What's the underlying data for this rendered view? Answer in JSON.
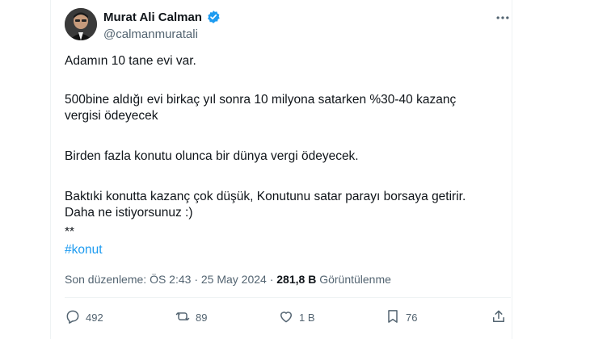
{
  "author": {
    "name": "Murat Ali Calman",
    "handle": "@calmanmuratali"
  },
  "tweet": {
    "p1": "Adamın 10 tane evi var.",
    "p2_line1": "500bine aldığı evi birkaç yıl sonra 10 milyona satarken %30-40 kazanç",
    "p2_line2": "vergisi ödeyecek",
    "p3": "Birden fazla konutu olunca bir dünya vergi ödeyecek.",
    "p4_line1": "Baktıki konutta kazanç çok düşük, Konutunu satar parayı borsaya getirir.",
    "p4_line2": "Daha ne istiyorsunuz :)",
    "p5": "**",
    "hashtag": "#konut"
  },
  "meta": {
    "edited": "Son düzenleme: ÖS 2:43 · 25 May 2024 · ",
    "views_count": "281,8 B",
    "views_label": " Görüntülenme"
  },
  "actions": {
    "replies": "492",
    "reposts": "89",
    "likes": "1 B",
    "bookmarks": "76"
  },
  "colors": {
    "accent": "#1d9bf0",
    "muted": "#536471",
    "text": "#0f1419"
  }
}
